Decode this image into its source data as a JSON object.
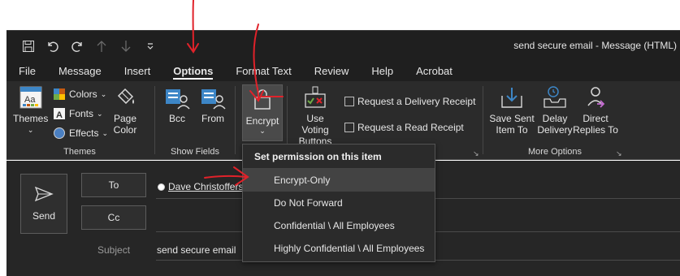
{
  "window": {
    "title": "send secure email  -  Message (HTML)"
  },
  "quick_access": [
    "save-icon",
    "undo-icon",
    "redo-icon",
    "up-arrow-icon",
    "down-arrow-icon",
    "customize-icon"
  ],
  "tabs": [
    {
      "label": "File",
      "active": false
    },
    {
      "label": "Message",
      "active": false
    },
    {
      "label": "Insert",
      "active": false
    },
    {
      "label": "Options",
      "active": true
    },
    {
      "label": "Format Text",
      "active": false
    },
    {
      "label": "Review",
      "active": false
    },
    {
      "label": "Help",
      "active": false
    },
    {
      "label": "Acrobat",
      "active": false
    }
  ],
  "ribbon": {
    "themes": {
      "themes_label": "Themes",
      "colors_label": "Colors",
      "fonts_label": "Fonts",
      "effects_label": "Effects",
      "page_color_label_1": "Page",
      "page_color_label_2": "Color",
      "group_label": "Themes"
    },
    "show_fields": {
      "bcc_label": "Bcc",
      "from_label": "From",
      "group_label": "Show Fields"
    },
    "encrypt": {
      "label": "Encrypt"
    },
    "tracking": {
      "voting_label_1": "Use Voting",
      "voting_label_2": "Buttons",
      "delivery_receipt_label": "Request a Delivery Receipt",
      "read_receipt_label": "Request a Read Receipt"
    },
    "more_options": {
      "save_sent_1": "Save Sent",
      "save_sent_2": "Item To",
      "delay_1": "Delay",
      "delay_2": "Delivery",
      "direct_1": "Direct",
      "direct_2": "Replies To",
      "group_label": "More Options"
    }
  },
  "compose": {
    "send_label": "Send",
    "to_label": "To",
    "cc_label": "Cc",
    "subject_label": "Subject",
    "recipient": "Dave Christoffers",
    "subject_value": "send secure email"
  },
  "dropdown": {
    "header": "Set permission on this item",
    "items": [
      "Encrypt-Only",
      "Do Not Forward",
      "Confidential \\ All Employees",
      "Highly Confidential \\ All Employees"
    ],
    "hovered_index": 0
  },
  "colors": {
    "annotation": "#e0222a",
    "ribbon_bg": "#2b2b2b",
    "titlebar_bg": "#1f1f1f"
  }
}
